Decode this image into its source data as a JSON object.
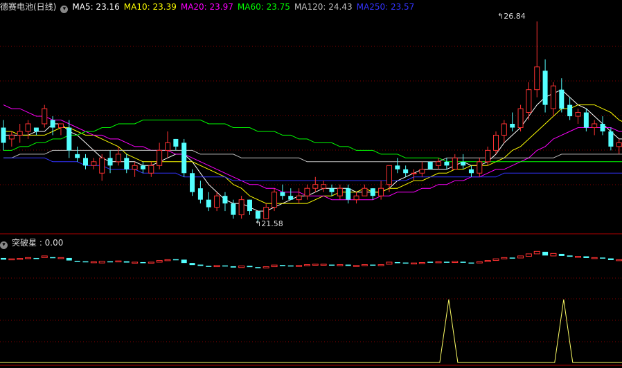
{
  "header": {
    "stock_name": "德赛电池(日线)",
    "ma_labels": [
      {
        "text": "MA5: 23.16",
        "color": "#ffffff"
      },
      {
        "text": "MA10: 23.39",
        "color": "#ffff00"
      },
      {
        "text": "MA20: 23.97",
        "color": "#ff00ff"
      },
      {
        "text": "MA60: 23.75",
        "color": "#00ff00"
      },
      {
        "text": "MA120: 24.43",
        "color": "#c0c0c0"
      },
      {
        "text": "MA250: 23.57",
        "color": "#3333ff"
      }
    ]
  },
  "sub_header": {
    "label": "突破星 : 0.00"
  },
  "annotations": {
    "high_label": "26.84",
    "low_label": "21.58"
  },
  "colors": {
    "up": "#ff3232",
    "down": "#54ffff",
    "grid": "#8b0000",
    "spike": "#ffff66"
  },
  "chart_data": {
    "type": "candlestick",
    "candles": [
      [
        24.0,
        24.2,
        23.4,
        23.6
      ],
      [
        23.7,
        23.9,
        23.5,
        23.8
      ],
      [
        23.8,
        24.1,
        23.6,
        23.9
      ],
      [
        23.9,
        24.2,
        23.7,
        24.1
      ],
      [
        24.0,
        24.0,
        23.8,
        23.9
      ],
      [
        24.1,
        24.6,
        24.0,
        24.5
      ],
      [
        24.2,
        24.3,
        23.8,
        24.0
      ],
      [
        24.0,
        24.1,
        23.8,
        24.1
      ],
      [
        24.0,
        24.2,
        23.2,
        23.4
      ],
      [
        23.3,
        23.5,
        23.1,
        23.2
      ],
      [
        23.2,
        23.3,
        22.9,
        23.0
      ],
      [
        23.0,
        23.2,
        22.9,
        23.1
      ],
      [
        22.8,
        23.3,
        22.6,
        23.2
      ],
      [
        23.2,
        23.4,
        22.8,
        23.0
      ],
      [
        23.1,
        23.5,
        23.0,
        23.3
      ],
      [
        23.2,
        23.3,
        22.8,
        22.9
      ],
      [
        22.9,
        23.1,
        22.7,
        23.0
      ],
      [
        23.0,
        23.1,
        22.8,
        22.9
      ],
      [
        22.8,
        23.1,
        22.7,
        23.0
      ],
      [
        23.0,
        23.6,
        22.9,
        23.4
      ],
      [
        23.4,
        23.9,
        23.2,
        23.6
      ],
      [
        23.7,
        23.7,
        23.4,
        23.5
      ],
      [
        23.6,
        23.7,
        22.7,
        22.8
      ],
      [
        22.8,
        22.9,
        22.2,
        22.3
      ],
      [
        22.4,
        22.6,
        22.0,
        22.1
      ],
      [
        22.1,
        22.3,
        21.8,
        21.9
      ],
      [
        21.9,
        22.3,
        21.8,
        22.2
      ],
      [
        22.2,
        22.3,
        21.8,
        22.0
      ],
      [
        22.0,
        22.1,
        21.6,
        21.7
      ],
      [
        21.7,
        22.2,
        21.6,
        22.1
      ],
      [
        22.1,
        22.1,
        21.7,
        21.8
      ],
      [
        21.8,
        21.8,
        21.5,
        21.6
      ],
      [
        21.6,
        22.0,
        21.6,
        21.9
      ],
      [
        21.9,
        22.4,
        21.8,
        22.3
      ],
      [
        22.3,
        22.5,
        22.1,
        22.2
      ],
      [
        22.2,
        22.4,
        22.1,
        22.1
      ],
      [
        22.1,
        22.4,
        22.0,
        22.2
      ],
      [
        22.2,
        22.5,
        22.1,
        22.4
      ],
      [
        22.4,
        22.7,
        22.3,
        22.5
      ],
      [
        22.4,
        22.6,
        22.3,
        22.5
      ],
      [
        22.4,
        22.5,
        22.2,
        22.3
      ],
      [
        22.2,
        22.5,
        22.1,
        22.4
      ],
      [
        22.4,
        22.5,
        22.0,
        22.1
      ],
      [
        22.1,
        22.3,
        22.0,
        22.2
      ],
      [
        22.2,
        22.5,
        22.2,
        22.4
      ],
      [
        22.4,
        22.4,
        22.1,
        22.2
      ],
      [
        22.2,
        22.6,
        22.1,
        22.4
      ],
      [
        22.5,
        23.0,
        22.3,
        23.0
      ],
      [
        23.0,
        23.2,
        22.8,
        22.9
      ],
      [
        22.9,
        23.0,
        22.7,
        22.8
      ],
      [
        22.8,
        22.9,
        22.6,
        22.8
      ],
      [
        22.8,
        23.1,
        22.7,
        22.9
      ],
      [
        23.1,
        23.1,
        22.9,
        22.9
      ],
      [
        23.0,
        23.2,
        22.9,
        23.1
      ],
      [
        23.1,
        23.2,
        22.9,
        23.0
      ],
      [
        22.9,
        23.3,
        22.9,
        23.2
      ],
      [
        23.1,
        23.3,
        22.9,
        23.0
      ],
      [
        22.9,
        23.0,
        22.7,
        22.8
      ],
      [
        22.8,
        23.2,
        22.7,
        23.1
      ],
      [
        23.1,
        23.5,
        23.0,
        23.4
      ],
      [
        23.4,
        23.9,
        23.3,
        23.8
      ],
      [
        23.8,
        24.2,
        23.6,
        24.1
      ],
      [
        24.1,
        24.4,
        23.9,
        24.0
      ],
      [
        24.0,
        24.6,
        23.9,
        24.5
      ],
      [
        24.4,
        25.2,
        24.2,
        25.0
      ],
      [
        25.0,
        26.8,
        24.8,
        25.6
      ],
      [
        25.5,
        25.8,
        24.4,
        24.6
      ],
      [
        24.5,
        25.2,
        24.3,
        25.1
      ],
      [
        25.0,
        25.3,
        24.4,
        24.5
      ],
      [
        24.6,
        24.8,
        24.2,
        24.3
      ],
      [
        24.3,
        24.5,
        24.1,
        24.4
      ],
      [
        24.4,
        24.5,
        23.9,
        24.0
      ],
      [
        24.0,
        24.2,
        23.8,
        24.1
      ],
      [
        24.1,
        24.3,
        23.8,
        23.9
      ],
      [
        23.9,
        24.0,
        23.4,
        23.5
      ],
      [
        23.5,
        23.7,
        23.3,
        23.6
      ],
      [
        23.5,
        23.8,
        23.3,
        23.7
      ],
      [
        23.6,
        23.9,
        23.5,
        23.8
      ]
    ],
    "ma": [
      {
        "name": "MA5",
        "color": "#ffffff",
        "values": [
          23.8,
          23.8,
          23.8,
          23.8,
          23.9,
          23.9,
          24.1,
          24.1,
          23.9,
          23.8,
          23.6,
          23.4,
          23.2,
          23.1,
          23.1,
          23.1,
          23.1,
          23.0,
          23.0,
          23.1,
          23.2,
          23.3,
          23.3,
          23.1,
          22.8,
          22.5,
          22.3,
          22.1,
          22.0,
          22.0,
          21.9,
          21.8,
          21.8,
          21.9,
          22.0,
          22.1,
          22.2,
          22.2,
          22.3,
          22.4,
          22.4,
          22.4,
          22.4,
          22.3,
          22.3,
          22.3,
          22.3,
          22.4,
          22.6,
          22.7,
          22.8,
          22.9,
          22.9,
          22.9,
          22.9,
          23.0,
          23.1,
          23.0,
          23.0,
          23.1,
          23.3,
          23.6,
          23.8,
          24.0,
          24.3,
          24.6,
          24.8,
          24.9,
          25.0,
          24.8,
          24.6,
          24.5,
          24.3,
          24.1,
          23.9,
          23.7,
          23.7,
          23.7
        ]
      },
      {
        "name": "MA10",
        "color": "#ffff00",
        "values": [
          23.9,
          23.9,
          23.8,
          23.8,
          23.8,
          23.8,
          23.9,
          24.0,
          24.0,
          23.9,
          23.8,
          23.8,
          23.7,
          23.6,
          23.5,
          23.3,
          23.2,
          23.1,
          23.1,
          23.1,
          23.1,
          23.1,
          23.1,
          23.1,
          23.0,
          22.9,
          22.8,
          22.7,
          22.5,
          22.4,
          22.2,
          22.1,
          22.0,
          22.0,
          22.0,
          22.0,
          22.0,
          22.0,
          22.1,
          22.2,
          22.2,
          22.3,
          22.3,
          22.3,
          22.4,
          22.3,
          22.3,
          22.4,
          22.4,
          22.5,
          22.6,
          22.6,
          22.7,
          22.8,
          22.8,
          22.9,
          22.9,
          23.0,
          23.0,
          23.0,
          23.1,
          23.2,
          23.4,
          23.5,
          23.7,
          23.9,
          24.1,
          24.3,
          24.5,
          24.5,
          24.6,
          24.6,
          24.6,
          24.5,
          24.4,
          24.2,
          24.1,
          23.9
        ]
      },
      {
        "name": "MA20",
        "color": "#ff00ff",
        "values": [
          24.6,
          24.5,
          24.5,
          24.4,
          24.3,
          24.3,
          24.2,
          24.2,
          24.1,
          24.0,
          23.9,
          23.8,
          23.8,
          23.7,
          23.7,
          23.6,
          23.5,
          23.5,
          23.4,
          23.4,
          23.4,
          23.3,
          23.3,
          23.2,
          23.1,
          23.0,
          22.9,
          22.8,
          22.7,
          22.6,
          22.5,
          22.5,
          22.4,
          22.4,
          22.3,
          22.3,
          22.3,
          22.2,
          22.2,
          22.2,
          22.1,
          22.1,
          22.1,
          22.1,
          22.1,
          22.1,
          22.2,
          22.2,
          22.3,
          22.3,
          22.3,
          22.4,
          22.4,
          22.5,
          22.5,
          22.6,
          22.6,
          22.7,
          22.7,
          22.8,
          22.9,
          22.9,
          23.0,
          23.1,
          23.2,
          23.4,
          23.5,
          23.7,
          23.8,
          23.9,
          24.0,
          24.0,
          24.0,
          24.0,
          24.0,
          23.9,
          23.9,
          24.0
        ]
      },
      {
        "name": "MA60",
        "color": "#00ff00",
        "values": [
          23.4,
          23.4,
          23.5,
          23.5,
          23.6,
          23.6,
          23.7,
          23.7,
          23.8,
          23.8,
          23.9,
          23.9,
          24.0,
          24.0,
          24.1,
          24.1,
          24.1,
          24.2,
          24.2,
          24.2,
          24.2,
          24.2,
          24.2,
          24.2,
          24.2,
          24.1,
          24.1,
          24.1,
          24.0,
          24.0,
          24.0,
          23.9,
          23.9,
          23.9,
          23.8,
          23.8,
          23.7,
          23.7,
          23.6,
          23.6,
          23.6,
          23.5,
          23.5,
          23.4,
          23.4,
          23.4,
          23.3,
          23.3,
          23.3,
          23.2,
          23.2,
          23.2,
          23.2,
          23.2,
          23.1,
          23.1,
          23.1,
          23.1,
          23.1,
          23.1,
          23.1,
          23.1,
          23.1,
          23.1,
          23.1,
          23.1,
          23.1,
          23.1,
          23.1,
          23.1,
          23.1,
          23.1,
          23.1,
          23.1,
          23.1,
          23.1,
          23.1,
          23.1
        ]
      },
      {
        "name": "MA120",
        "color": "#c0c0c0",
        "values": [
          23.2,
          23.2,
          23.3,
          23.3,
          23.3,
          23.3,
          23.4,
          23.4,
          23.4,
          23.4,
          23.4,
          23.4,
          23.4,
          23.4,
          23.4,
          23.4,
          23.4,
          23.4,
          23.4,
          23.4,
          23.4,
          23.4,
          23.4,
          23.4,
          23.3,
          23.3,
          23.3,
          23.3,
          23.3,
          23.2,
          23.2,
          23.2,
          23.2,
          23.2,
          23.2,
          23.2,
          23.2,
          23.1,
          23.1,
          23.1,
          23.1,
          23.1,
          23.1,
          23.1,
          23.1,
          23.1,
          23.1,
          23.1,
          23.1,
          23.1,
          23.1,
          23.1,
          23.1,
          23.1,
          23.2,
          23.2,
          23.2,
          23.2,
          23.2,
          23.2,
          23.2,
          23.2,
          23.2,
          23.2,
          23.2,
          23.2,
          23.2,
          23.2,
          23.3,
          23.3,
          23.3,
          23.3,
          23.3,
          23.3,
          23.3,
          23.3,
          23.3,
          23.3
        ]
      },
      {
        "name": "MA250",
        "color": "#3333ff",
        "values": [
          23.2,
          23.2,
          23.2,
          23.2,
          23.2,
          23.2,
          23.1,
          23.1,
          23.1,
          23.1,
          23.0,
          23.0,
          23.0,
          22.9,
          22.9,
          22.9,
          22.9,
          22.8,
          22.8,
          22.8,
          22.8,
          22.8,
          22.7,
          22.7,
          22.7,
          22.7,
          22.7,
          22.7,
          22.6,
          22.6,
          22.6,
          22.6,
          22.6,
          22.6,
          22.6,
          22.6,
          22.6,
          22.6,
          22.6,
          22.6,
          22.6,
          22.6,
          22.6,
          22.6,
          22.6,
          22.6,
          22.6,
          22.6,
          22.6,
          22.6,
          22.7,
          22.7,
          22.7,
          22.7,
          22.7,
          22.7,
          22.7,
          22.7,
          22.7,
          22.7,
          22.7,
          22.8,
          22.8,
          22.8,
          22.8,
          22.8,
          22.8,
          22.8,
          22.8,
          22.8,
          22.8,
          22.8,
          22.8,
          22.8,
          22.8,
          22.8,
          22.8,
          22.8
        ]
      }
    ],
    "indicator": {
      "name": "突破星",
      "spikes": [
        {
          "index": 54,
          "value": 1
        },
        {
          "index": 68,
          "value": 1
        }
      ]
    },
    "price_range": [
      21.2,
      27.0
    ]
  }
}
